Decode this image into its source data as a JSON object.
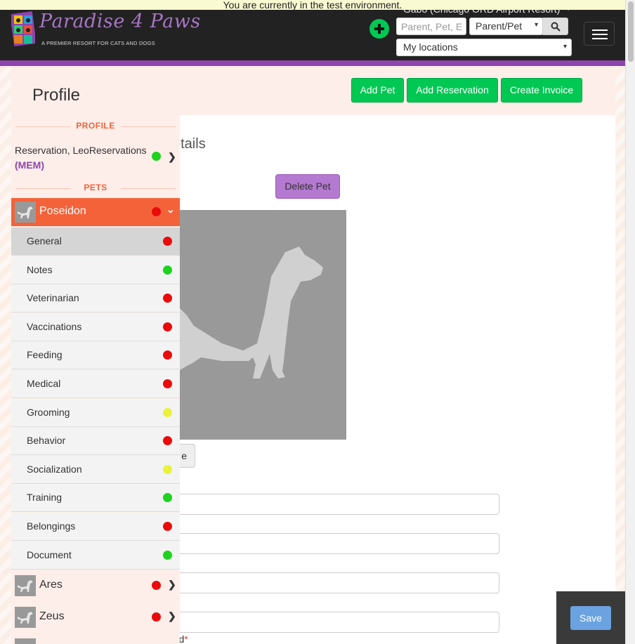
{
  "banner": {
    "text": "You are currently in the test environment."
  },
  "logo": {
    "title": "Paradise 4 Paws",
    "tagline": "A PREMIER RESORT FOR CATS AND DOGS"
  },
  "header": {
    "user_location": "Gabo (Chicago ORD Airport Resort)",
    "search_placeholder": "Parent, Pet, Em",
    "search_type": "Parent/Pet",
    "locations": "My locations"
  },
  "page": {
    "title": "Profile",
    "buttons": {
      "add_pet": "Add Pet",
      "add_reservation": "Add Reservation",
      "create_invoice": "Create Invoice"
    },
    "details_heading": "etails",
    "delete_pet": "Delete Pet",
    "change_photo": "e",
    "required_label": "red",
    "required_star": "*",
    "save": "Save"
  },
  "sidebar": {
    "profile_section": "PROFILE",
    "reservation": {
      "name": "Reservation, LeoReservations",
      "badge": "(MEM)",
      "status": "green"
    },
    "pets_section": "PETS",
    "active_pet": {
      "name": "Poseidon",
      "status": "red"
    },
    "subitems": [
      {
        "label": "General",
        "status": "red"
      },
      {
        "label": "Notes",
        "status": "green"
      },
      {
        "label": "Veterinarian",
        "status": "red"
      },
      {
        "label": "Vaccinations",
        "status": "red"
      },
      {
        "label": "Feeding",
        "status": "red"
      },
      {
        "label": "Medical",
        "status": "red"
      },
      {
        "label": "Grooming",
        "status": "yellow"
      },
      {
        "label": "Behavior",
        "status": "red"
      },
      {
        "label": "Socialization",
        "status": "yellow"
      },
      {
        "label": "Training",
        "status": "green"
      },
      {
        "label": "Belongings",
        "status": "red"
      },
      {
        "label": "Document",
        "status": "green"
      }
    ],
    "other_pets": [
      {
        "name": "Ares",
        "status": "red"
      },
      {
        "name": "Zeus",
        "status": "red"
      }
    ]
  },
  "colors": {
    "accent_orange": "#f4623a",
    "accent_purple": "#8e44ad",
    "button_green": "#00c853",
    "status_red": "#ea0b0b",
    "status_green": "#1ed31e",
    "status_yellow": "#eaf33a"
  }
}
